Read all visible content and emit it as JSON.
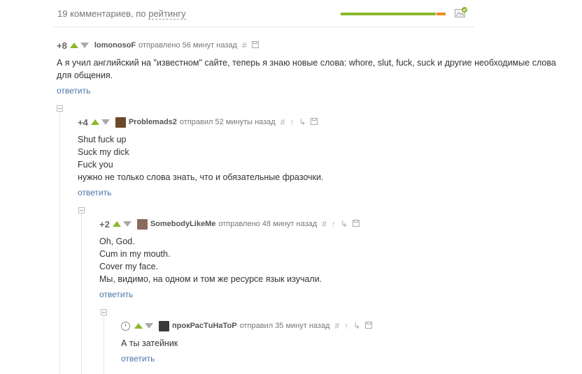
{
  "header": {
    "count_text": "19 комментариев, по",
    "sort_label": "рейтингу"
  },
  "rating": {
    "positive_share": 0.95
  },
  "comments": [
    {
      "score": "+8",
      "user": "lomonosoF",
      "action": "отправлено",
      "time": "56 минут назад",
      "lines": [
        "А я учил английский на \"известном\" сайте, теперь я знаю новые слова: whore, slut, fuck, suck и другие необходимые слова",
        "для общения."
      ],
      "reply_label": "ответить"
    },
    {
      "score": "+4",
      "user": "Problemads2",
      "action": "отправил",
      "time": "52 минуты назад",
      "lines": [
        "Shut fuck up",
        "Suck my dick",
        "Fuck you",
        "нужно не только слова знать, что и обязательные фразочки."
      ],
      "reply_label": "ответить"
    },
    {
      "score": "+2",
      "user": "SomebodyLikeMe",
      "action": "отправлено",
      "time": "48 минут назад",
      "lines": [
        "Oh, God.",
        "Cum in my mouth.",
        "Cover my face.",
        "Мы, видимо, на одном и том же ресурсе язык изучали."
      ],
      "reply_label": "ответить"
    },
    {
      "score": "",
      "user": "прокРасТuНаТоР",
      "action": "отправил",
      "time": "35 минут назад",
      "lines": [
        "А ты затейник"
      ],
      "reply_label": "ответить"
    }
  ],
  "icons": {
    "link": "hash-icon",
    "save": "save-icon",
    "parent": "arrow-up-icon",
    "branch": "branch-icon",
    "clock": "clock-icon"
  },
  "colors": {
    "upvote": "#8ab82c",
    "link": "#4a76a8",
    "rating_negative": "#f08a24"
  }
}
